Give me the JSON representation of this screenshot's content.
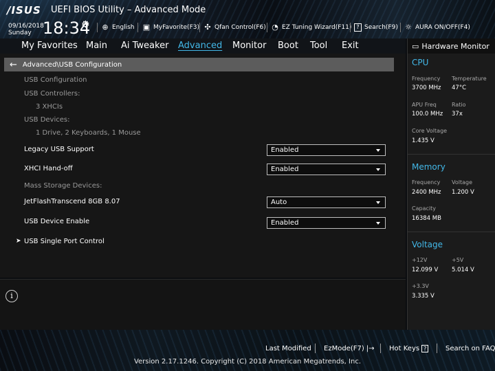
{
  "header": {
    "logo": "/ISUS",
    "title": "UEFI BIOS Utility – Advanced Mode",
    "date": "09/16/2018",
    "day": "Sunday",
    "time": "18:34",
    "buttons": [
      {
        "label": "English",
        "icon": "globe-icon"
      },
      {
        "label": "MyFavorite(F3)",
        "icon": "favorite-icon"
      },
      {
        "label": "Qfan Control(F6)",
        "icon": "fan-icon"
      },
      {
        "label": "EZ Tuning Wizard(F11)",
        "icon": "wizard-icon"
      },
      {
        "label": "Search(F9)",
        "icon": "search-icon"
      },
      {
        "label": "AURA ON/OFF(F4)",
        "icon": "aura-icon"
      }
    ]
  },
  "tabs": [
    "My Favorites",
    "Main",
    "Ai Tweaker",
    "Advanced",
    "Monitor",
    "Boot",
    "Tool",
    "Exit"
  ],
  "active_tab": "Advanced",
  "breadcrumb": "Advanced\\USB Configuration",
  "settings": {
    "usb_config": "USB Configuration",
    "usb_controllers_label": "USB Controllers:",
    "usb_controllers_value": "3 XHCIs",
    "usb_devices_label": "USB Devices:",
    "usb_devices_value": "1 Drive, 2 Keyboards, 1 Mouse",
    "legacy_label": "Legacy USB Support",
    "legacy_value": "Enabled",
    "xhci_label": "XHCI Hand-off",
    "xhci_value": "Enabled",
    "mass_storage_label": "Mass Storage Devices:",
    "jetflash_label": "JetFlashTranscend 8GB 8.07",
    "jetflash_value": "Auto",
    "device_enable_label": "USB Device Enable",
    "device_enable_value": "Enabled",
    "single_port_label": "USB Single Port Control"
  },
  "hardware_monitor": {
    "title": "Hardware Monitor",
    "cpu": {
      "heading": "CPU",
      "frequency_label": "Frequency",
      "frequency": "3700 MHz",
      "temperature_label": "Temperature",
      "temperature": "47°C",
      "apu_label": "APU Freq",
      "apu": "100.0 MHz",
      "ratio_label": "Ratio",
      "ratio": "37x",
      "core_voltage_label": "Core Voltage",
      "core_voltage": "1.435 V"
    },
    "memory": {
      "heading": "Memory",
      "frequency_label": "Frequency",
      "frequency": "2400 MHz",
      "voltage_label": "Voltage",
      "voltage": "1.200 V",
      "capacity_label": "Capacity",
      "capacity": "16384 MB"
    },
    "voltage": {
      "heading": "Voltage",
      "v12_label": "+12V",
      "v12": "12.099 V",
      "v5_label": "+5V",
      "v5": "5.014 V",
      "v33_label": "+3.3V",
      "v33": "3.335 V"
    }
  },
  "footer": {
    "last_modified": "Last Modified",
    "ezmode": "EzMode(F7)",
    "hotkeys": "Hot Keys",
    "hotkeys_key": "?",
    "search_faq": "Search on FAQ",
    "copyright": "Version 2.17.1246. Copyright (C) 2018 American Megatrends, Inc."
  },
  "colors": {
    "accent": "#43b8e8",
    "breadcrumb_bg": "#5c5c5c"
  }
}
